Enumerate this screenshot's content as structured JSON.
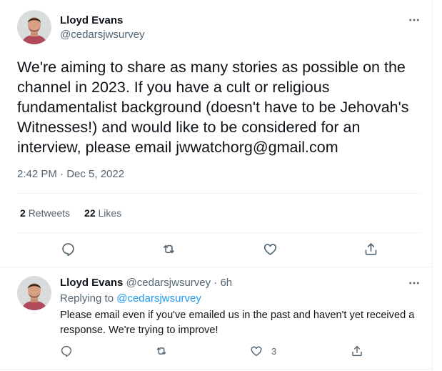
{
  "main_tweet": {
    "author_name": "Lloyd Evans",
    "author_handle": "@cedarsjwsurvey",
    "text": "We're aiming to share as many stories as possible on the channel in 2023. If you have a cult or religious fundamentalist background (doesn't have to be Jehovah's Witnesses!) and would like to be considered for an interview, please email jwwatchorg@gmail.com",
    "timestamp": "2:42 PM · Dec 5, 2022",
    "retweets_count": "2",
    "retweets_label": "Retweets",
    "likes_count": "22",
    "likes_label": "Likes",
    "actions": [
      "reply-icon",
      "retweet-icon",
      "like-icon",
      "share-icon"
    ]
  },
  "reply_tweet": {
    "author_name": "Lloyd Evans",
    "author_handle": "@cedarsjwsurvey",
    "age": "6h",
    "replying_to_prefix": "Replying to",
    "replying_to_handle": "@cedarsjwsurvey",
    "text": "Please email even if you've emailed us in the past and haven't yet received a response. We're trying to improve!",
    "likes_count": "3",
    "actions": [
      "reply-icon",
      "retweet-icon",
      "like-icon",
      "share-icon"
    ]
  },
  "colors": {
    "text_primary": "#0f1419",
    "text_secondary": "#536471",
    "link": "#1d9bf0",
    "divider": "#eff3f4"
  }
}
